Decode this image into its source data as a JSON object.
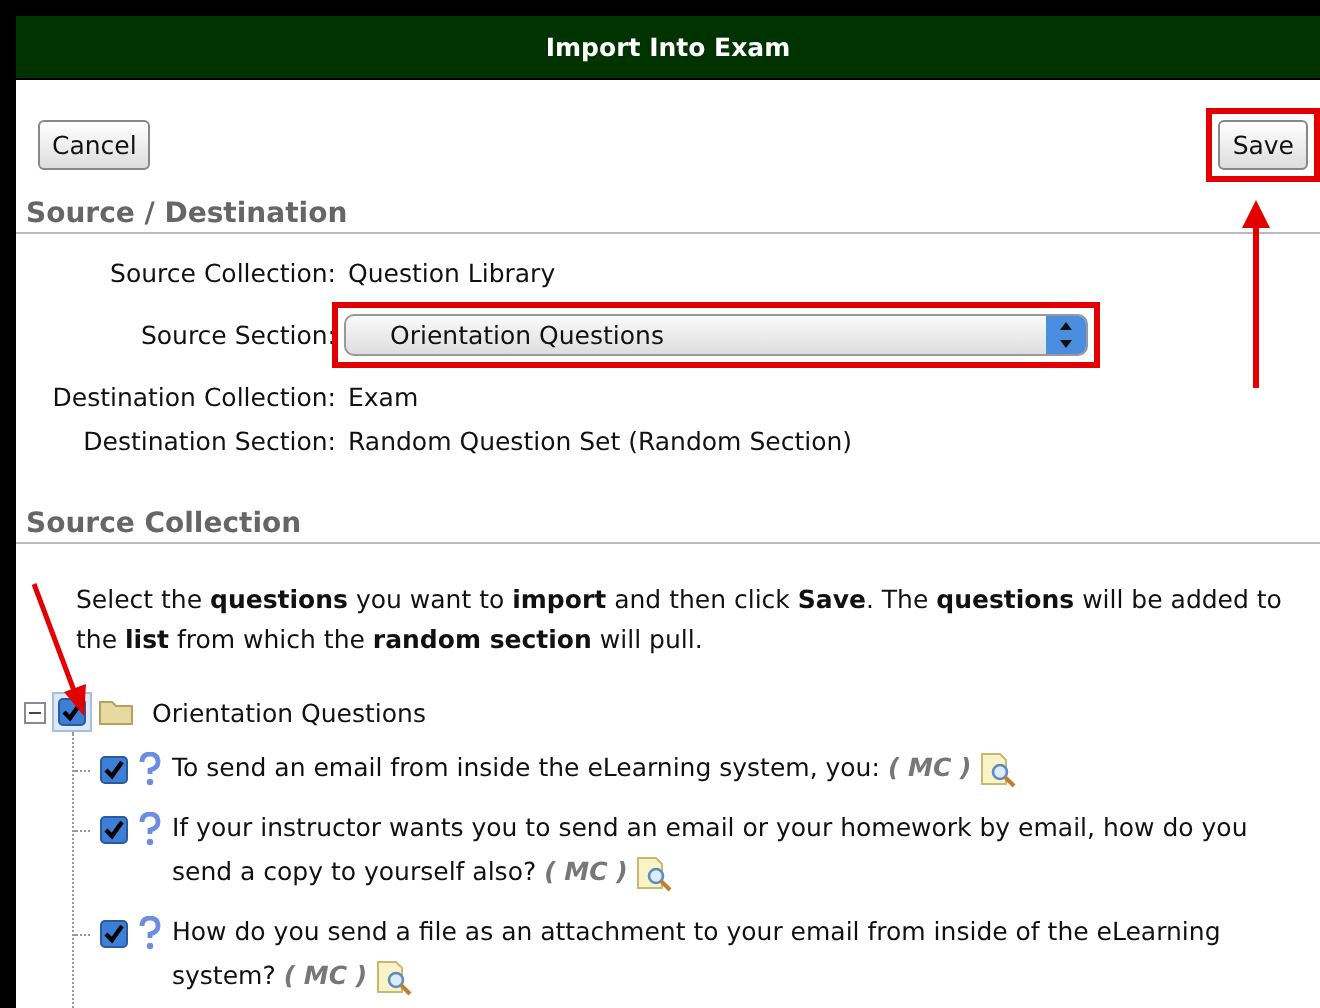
{
  "window": {
    "title": "Import Into Exam"
  },
  "buttons": [
    {
      "label": "Cancel",
      "highlighted": false
    },
    {
      "label": "Save",
      "highlighted": true
    }
  ],
  "source_destination": {
    "heading": "Source / Destination",
    "fields": [
      {
        "label": "Source Collection:",
        "kind": "text",
        "value": "Question Library"
      },
      {
        "label": "Source Section:",
        "kind": "select",
        "value": "Orientation Questions",
        "highlighted": true
      },
      {
        "label": "Destination Collection:",
        "kind": "text",
        "value": "Exam"
      },
      {
        "label": "Destination Section:",
        "kind": "text",
        "value": "Random Question Set (Random Section)"
      }
    ]
  },
  "source_collection": {
    "heading": "Source Collection",
    "instructions": "Select the **questions** you want to **import** and then click **Save**. The **questions** will be added to the **list** from which the **random section** will pull.",
    "tree": [
      {
        "label": "Orientation Questions",
        "expanded": true,
        "checked": true,
        "highlighted": true,
        "children": [
          {
            "label": "To send an email from inside the eLearning system, you:",
            "tag": "( MC )",
            "checked": true
          },
          {
            "label": "If your instructor wants you to send an email or your homework by email, how do you send a copy to yourself also?",
            "tag": "( MC )",
            "checked": true
          },
          {
            "label": "How do you send a file as an attachment to your email from inside of the eLearning system?",
            "tag": "( MC )",
            "checked": true
          }
        ]
      }
    ]
  }
}
